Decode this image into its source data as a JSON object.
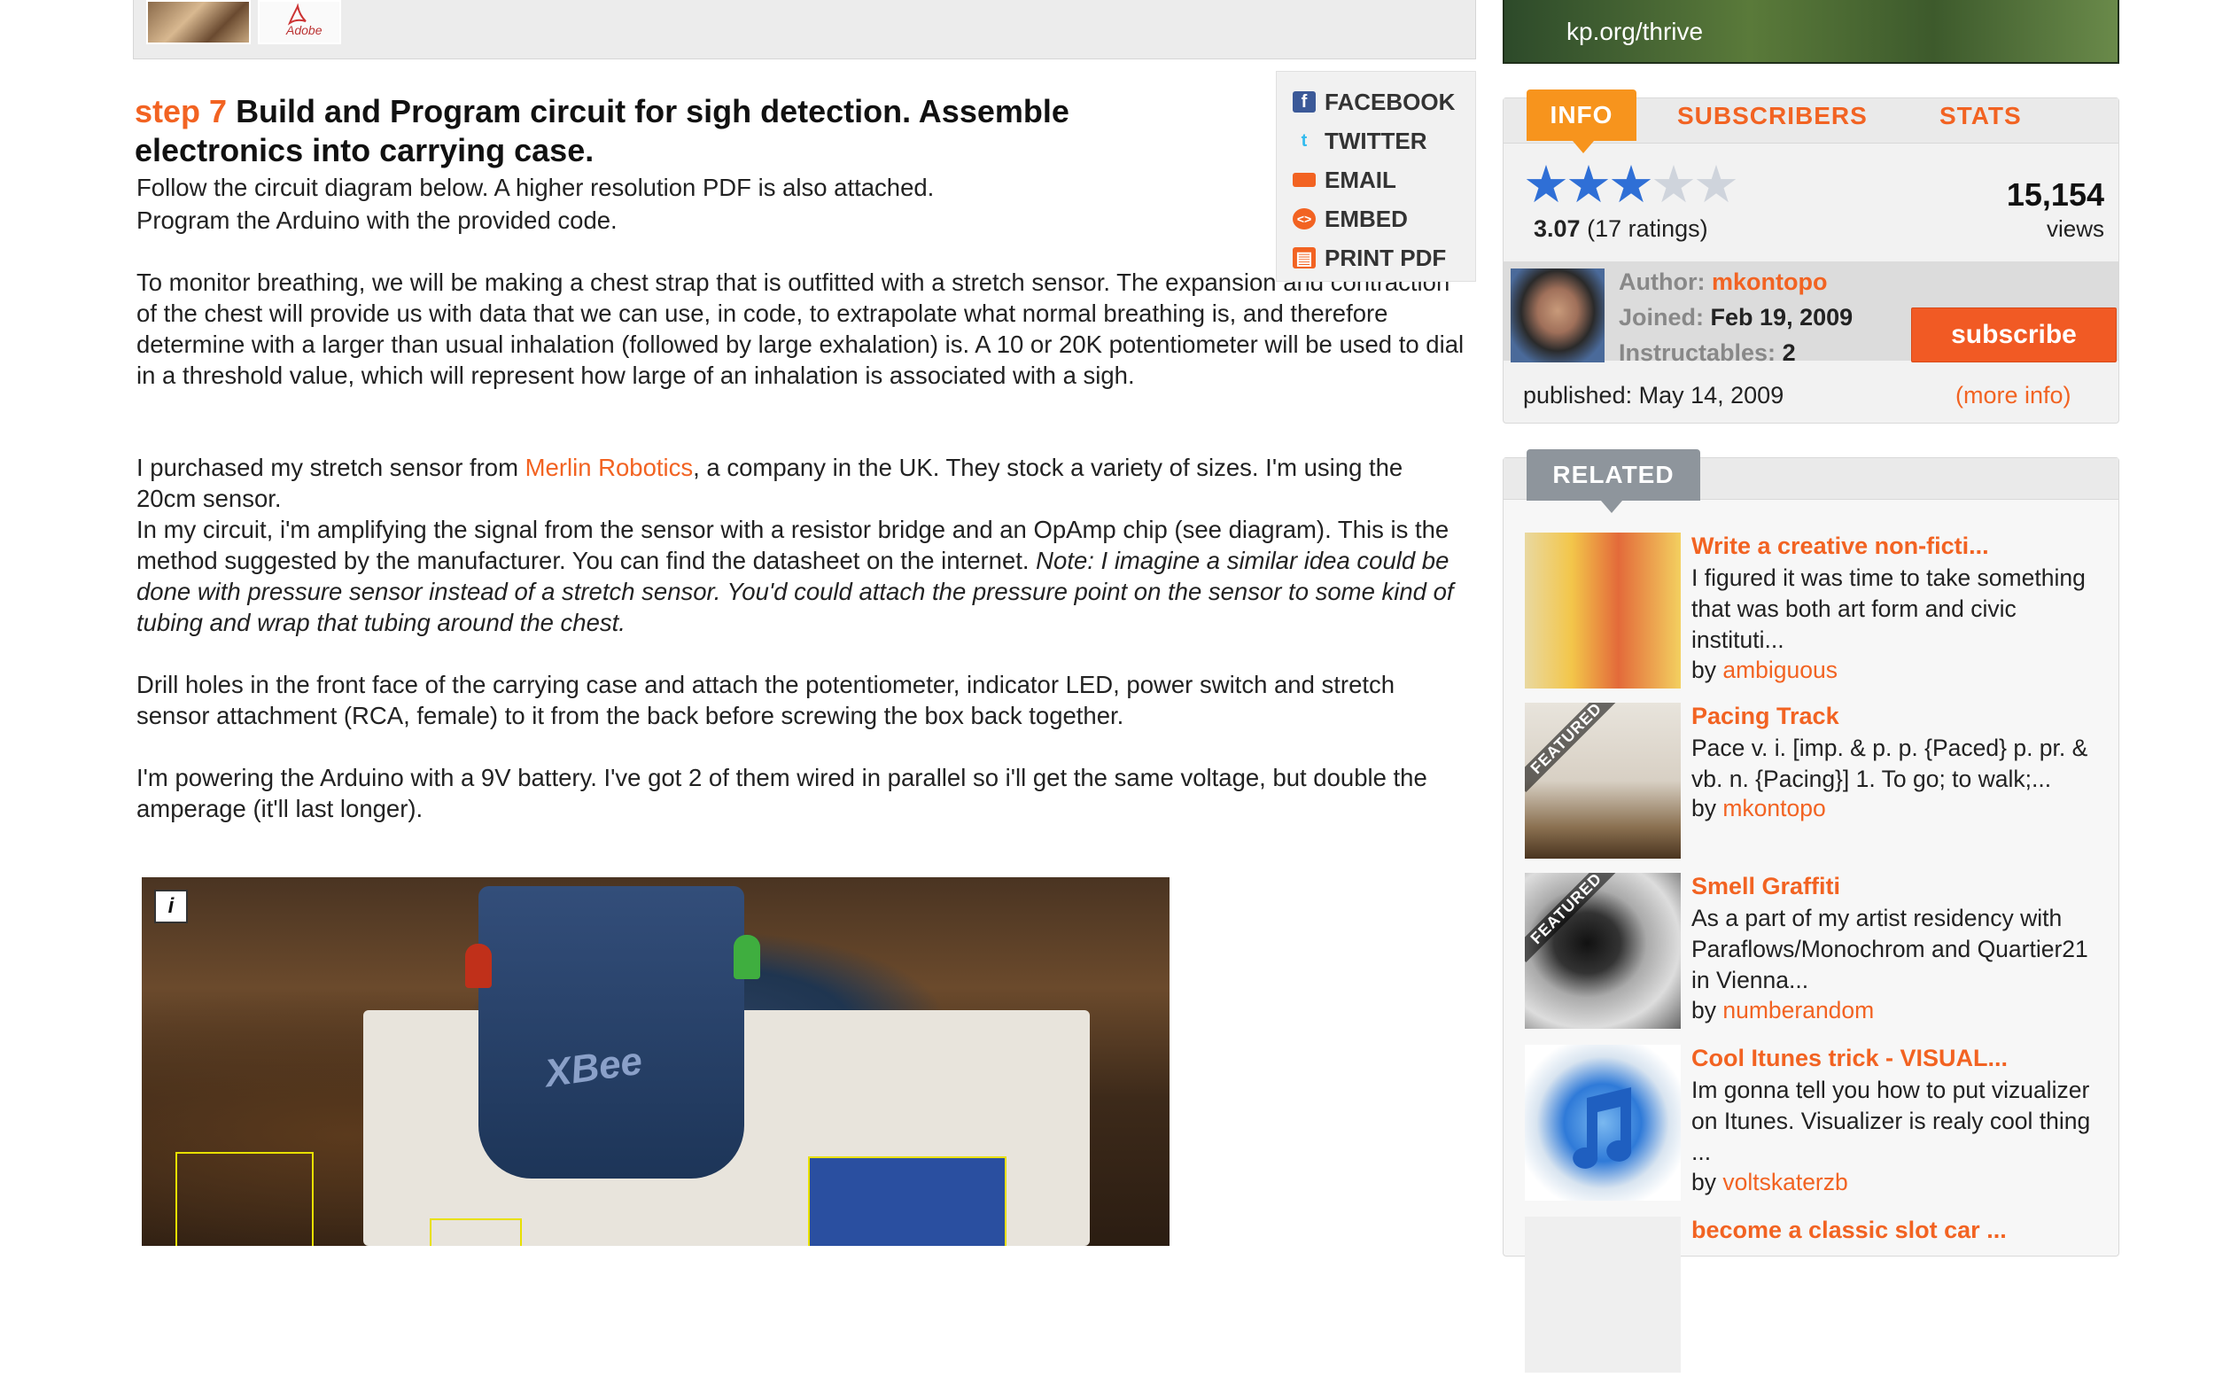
{
  "attachments": {
    "adobe_label": "Adobe"
  },
  "step": {
    "number_label": "step 7",
    "title": "Build and Program circuit for sigh detection. Assemble electronics into carrying case.",
    "intro_1": "Follow the circuit diagram below. A higher resolution PDF is also attached.",
    "intro_2": "Program the Arduino with the provided code.",
    "p1": "To monitor breathing, we will be making a chest strap that is outfitted with a stretch sensor. The expansion and contraction of the chest will provide us with data that we can use, in code, to extrapolate what normal breathing is, and therefore determine with a larger than usual inhalation (followed by large exhalation) is. A 10 or 20K potentiometer will be used to dial in a threshold value, which will represent how large of an inhalation is associated with a sigh.",
    "p2_before_link": "I purchased my stretch sensor from ",
    "p2_link": "Merlin Robotics",
    "p2_after_link": ", a company in the UK. They stock a variety of sizes. I'm using the 20cm sensor.",
    "p3_normal": "In my circuit, i'm amplifying the signal from the sensor with a resistor bridge and an OpAmp chip (see diagram). This is the method suggested by the manufacturer. You can find the datasheet on the internet. ",
    "p3_italic": "Note: I imagine a similar idea could be done with pressure sensor instead of a stretch sensor. You'd could attach the pressure point on the sensor to some kind of tubing and wrap that tubing around the chest.",
    "p4": "Drill holes in the front face of the carrying case and attach the potentiometer, indicator LED, power switch and stretch sensor attachment (RCA, female) to it from the back before screwing the box back together.",
    "p5": "I'm powering the Arduino with a 9V battery. I've got 2 of them wired in parallel so i'll get the same voltage, but double the amperage (it'll last longer)."
  },
  "share": {
    "facebook": "FACEBOOK",
    "twitter": "TWITTER",
    "email": "EMAIL",
    "embed": "EMBED",
    "print_pdf": "PRINT PDF"
  },
  "photo": {
    "info_badge": "i",
    "xbee_label": "XBee"
  },
  "ad": {
    "url": "kp.org/thrive"
  },
  "info_panel": {
    "tabs": [
      "INFO",
      "SUBSCRIBERS",
      "STATS"
    ],
    "rating_stars": 3,
    "rating_value": "3.07",
    "rating_count": "(17 ratings)",
    "views_count": "15,154",
    "views_label": "views",
    "author_label": "Author:",
    "author": "mkontopo",
    "joined_label": "Joined:",
    "joined": "Feb 19, 2009",
    "instructables_label": "Instructables:",
    "instructables": "2",
    "subscribe": "subscribe",
    "published": "published: May 14, 2009",
    "more_info": "(more info)"
  },
  "related": {
    "header": "RELATED",
    "featured_label": "FEATURED",
    "items": [
      {
        "title": "Write a creative non-ficti...",
        "desc": "I figured it was time to take something that was both art form and civic instituti...",
        "by": "by ",
        "author": "ambiguous"
      },
      {
        "title": "Pacing Track",
        "desc": "Pace v. i. [imp. & p. p. {Paced} p. pr. & vb. n. {Pacing}] 1. To go; to walk;...",
        "by": "by ",
        "author": "mkontopo"
      },
      {
        "title": "Smell Graffiti",
        "desc": "As a part of my artist residency with Paraflows/Monochrom and Quartier21 in Vienna...",
        "by": "by ",
        "author": "numberandom"
      },
      {
        "title": "Cool Itunes trick - VISUAL...",
        "desc": "Im gonna tell you how to put vizualizer on Itunes. Visualizer is realy cool thing ...",
        "by": "by ",
        "author": "voltskaterzb"
      },
      {
        "title": "become a classic slot car ..."
      }
    ]
  },
  "colors": {
    "accent": "#f26322",
    "info_tab": "#f7941d",
    "subscribe": "#f15a24",
    "star": "#2f6fd6"
  }
}
